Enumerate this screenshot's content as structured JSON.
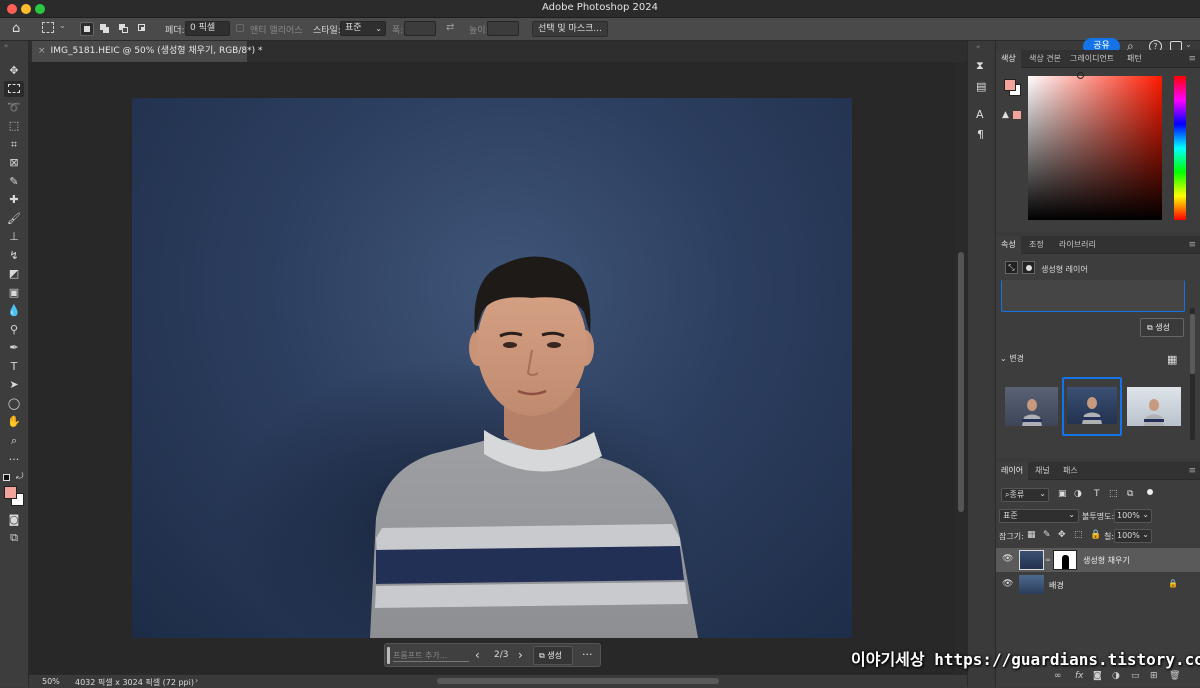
{
  "app": {
    "title": "Adobe Photoshop 2024"
  },
  "options_bar": {
    "feather_label": "페더:",
    "feather_value": "0 픽셀",
    "antialias_label": "앤티 앨리어스",
    "style_label": "스타일:",
    "style_value": "표준",
    "width_label": "폭:",
    "height_label": "높이:",
    "select_mask_button": "선택 및 마스크...",
    "share_button": "공유"
  },
  "document": {
    "tab_title": "IMG_5181.HEIC @ 50% (생성형 채우기, RGB/8*) *"
  },
  "status": {
    "zoom": "50%",
    "doc_info": "4032 픽셀 x 3024 픽셀 (72 ppi)"
  },
  "contextual_bar": {
    "prompt_placeholder": "프롬프트 추가...",
    "variation_counter": "2/3",
    "generate_button": "생성"
  },
  "color_panel": {
    "tabs": [
      "색상",
      "색상 견본",
      "그레이디언트",
      "패턴"
    ],
    "foreground_color": "#f2a49c",
    "background_color": "#ffffff"
  },
  "properties_panel": {
    "tabs": [
      "속성",
      "조정",
      "라이브러리"
    ],
    "layer_type_label": "생성형 레이어",
    "generate_button": "생성",
    "variations_label": "변경",
    "variation_count": 3,
    "selected_variation": 2
  },
  "layers_panel": {
    "tabs": [
      "레이어",
      "채널",
      "패스"
    ],
    "filter_label": "종류",
    "blend_mode": "표준",
    "opacity_label": "불투명도:",
    "opacity_value": "100%",
    "lock_label": "잠그기:",
    "fill_label": "칠:",
    "fill_value": "100%",
    "layers": [
      {
        "name": "생성형 채우기",
        "selected": true
      },
      {
        "name": "배경",
        "locked": true
      }
    ]
  },
  "watermark": "이야기세상 https://guardians.tistory.com"
}
